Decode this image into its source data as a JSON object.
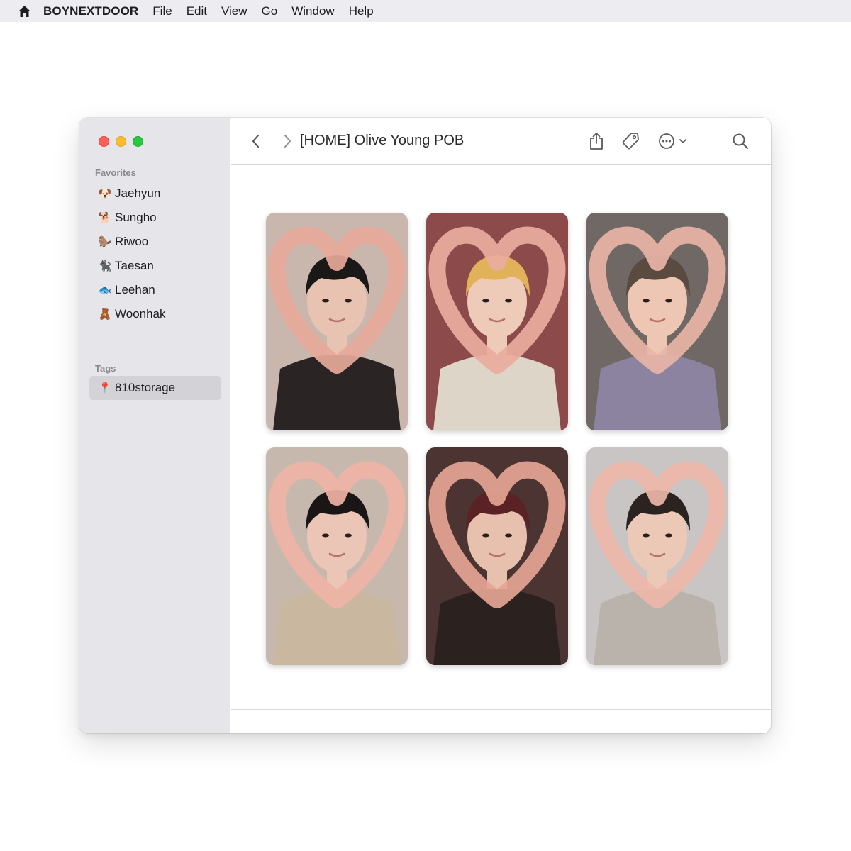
{
  "menubar": {
    "icon": "house-icon",
    "app_name": "BOYNEXTDOOR",
    "items": [
      "File",
      "Edit",
      "View",
      "Go",
      "Window",
      "Help"
    ]
  },
  "sidebar": {
    "favorites_label": "Favorites",
    "favorites": [
      {
        "emoji": "🐶",
        "label": "Jaehyun"
      },
      {
        "emoji": "🐕",
        "label": "Sungho"
      },
      {
        "emoji": "🦫",
        "label": "Riwoo"
      },
      {
        "emoji": "🐈‍⬛",
        "label": "Taesan"
      },
      {
        "emoji": "🐟",
        "label": "Leehan"
      },
      {
        "emoji": "🧸",
        "label": "Woonhak"
      }
    ],
    "tags_label": "Tags",
    "tags": [
      {
        "emoji": "📍",
        "label": "810storage",
        "selected": true
      }
    ]
  },
  "toolbar": {
    "title": "[HOME] Olive Young POB",
    "back_icon": "chevron-left-icon",
    "forward_icon": "chevron-right-icon",
    "share_icon": "share-icon",
    "tag_icon": "tag-icon",
    "more_icon": "ellipsis-circle-icon",
    "search_icon": "search-icon"
  },
  "colors": {
    "menubar_bg": "#ececf1",
    "sidebar_bg": "#e6e6ea",
    "selected_bg": "#d2d2d7",
    "close": "#fe5f57",
    "minimize": "#febc2e",
    "zoom": "#28c840"
  },
  "photos": [
    {
      "bg": "#c9b6ad",
      "hair": "#1b1818",
      "skin": "#e9c3b1",
      "shirt": "#2a2524",
      "hand": "#e6a99a"
    },
    {
      "bg": "#8d4a4b",
      "hair": "#e1b25a",
      "skin": "#edcbb8",
      "shirt": "#ddd5c8",
      "hand": "#e9ad9e"
    },
    {
      "bg": "#6f6865",
      "hair": "#5a4a40",
      "skin": "#eec6b4",
      "shirt": "#8c83a0",
      "hand": "#e8b4a6"
    },
    {
      "bg": "#c6b8ac",
      "hair": "#1a1616",
      "skin": "#ebc5b6",
      "shirt": "#c9b79f",
      "hand": "#eeb3a5"
    },
    {
      "bg": "#4b3431",
      "hair": "#5a2224",
      "skin": "#e8c0ae",
      "shirt": "#2b2220",
      "hand": "#e5a594"
    },
    {
      "bg": "#c8c5c4",
      "hair": "#2a2320",
      "skin": "#ecc9b7",
      "shirt": "#b9b3ac",
      "hand": "#edb7a8"
    }
  ]
}
